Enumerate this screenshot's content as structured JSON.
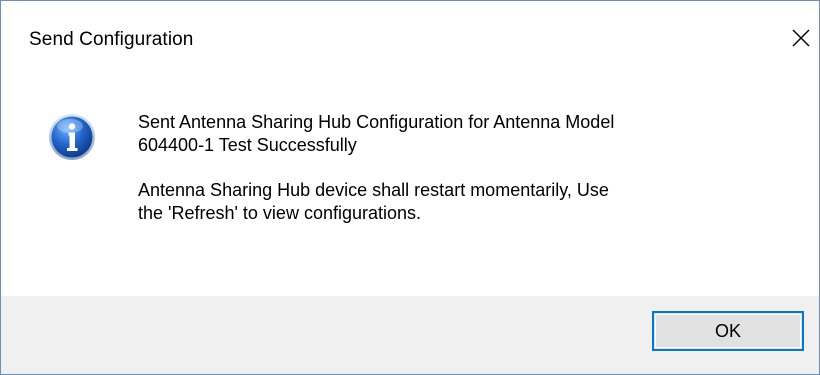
{
  "dialog": {
    "title": "Send Configuration",
    "close_icon": "close-icon",
    "icon": "information-icon",
    "message_line_1": "Sent Antenna Sharing Hub Configuration for Antenna Model\n604400-1 Test Successfully",
    "message_line_2": "Antenna Sharing Hub device shall restart momentarily, Use\nthe 'Refresh' to view configurations.",
    "ok_label": "OK"
  },
  "colors": {
    "accent": "#0078d7",
    "footer_bg": "#f0f0f0",
    "button_bg": "#e1e1e1",
    "info_icon_blue": "#1a5bb5"
  }
}
